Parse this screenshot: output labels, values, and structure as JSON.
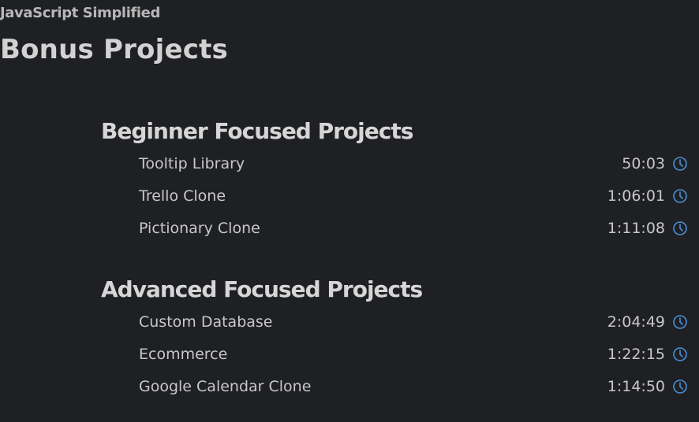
{
  "course": {
    "name": "JavaScript Simplified"
  },
  "page": {
    "title": "Bonus Projects"
  },
  "sections": [
    {
      "title": "Beginner Focused Projects",
      "lessons": [
        {
          "title": "Tooltip Library",
          "duration": "50:03",
          "icon": "clock-icon"
        },
        {
          "title": "Trello Clone",
          "duration": "1:06:01",
          "icon": "clock-icon"
        },
        {
          "title": "Pictionary Clone",
          "duration": "1:11:08",
          "icon": "clock-icon"
        }
      ]
    },
    {
      "title": "Advanced Focused Projects",
      "lessons": [
        {
          "title": "Custom Database",
          "duration": "2:04:49",
          "icon": "clock-icon"
        },
        {
          "title": "Ecommerce",
          "duration": "1:22:15",
          "icon": "clock-icon"
        },
        {
          "title": "Google Calendar Clone",
          "duration": "1:14:50",
          "icon": "clock-icon"
        }
      ]
    }
  ],
  "colors": {
    "background": "#1f2023",
    "text": "#c8c8c8",
    "accent": "#4a90d9"
  }
}
